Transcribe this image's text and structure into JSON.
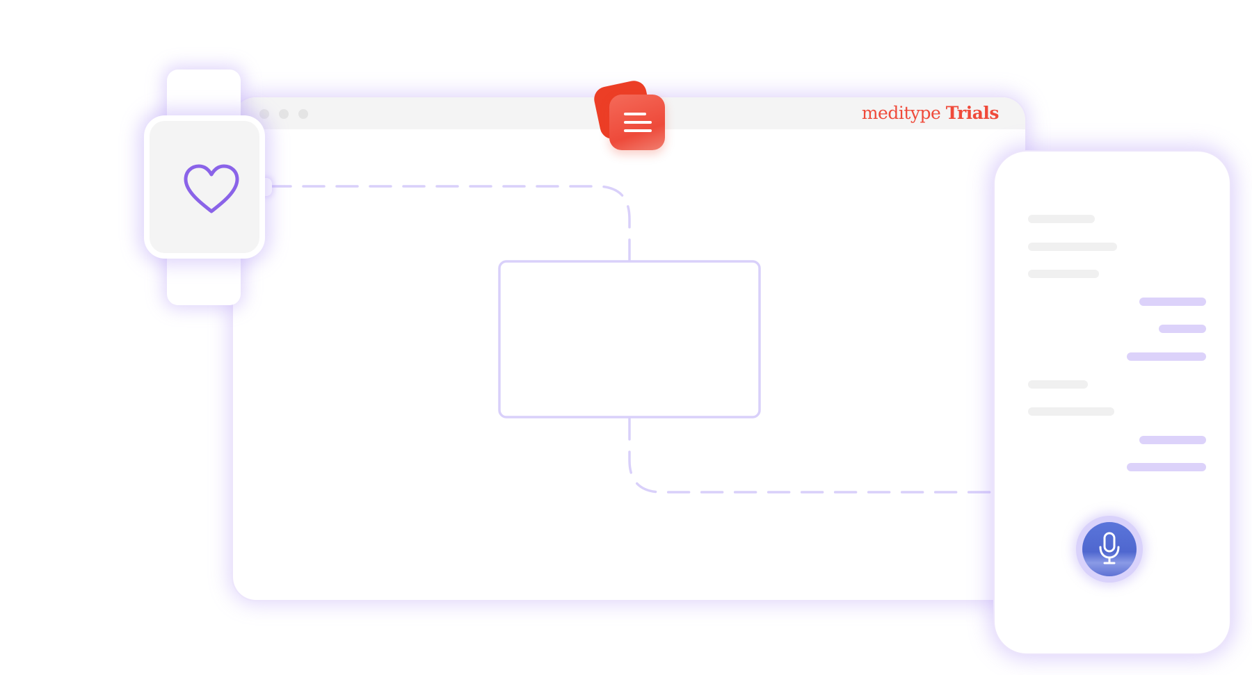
{
  "browser": {
    "brand": {
      "name": "meditype",
      "product": "Trials",
      "color": "#ef4a3a"
    },
    "window_controls": [
      "dot",
      "dot",
      "dot"
    ]
  },
  "watch": {
    "screen_icon": "heart-icon"
  },
  "app_badge": {
    "icon": "menu-icon",
    "color": "#ec3e26"
  },
  "phone": {
    "messages": [
      {
        "side": "incoming"
      },
      {
        "side": "incoming"
      },
      {
        "side": "incoming"
      },
      {
        "side": "outgoing"
      },
      {
        "side": "outgoing"
      },
      {
        "side": "outgoing"
      },
      {
        "side": "incoming"
      },
      {
        "side": "incoming"
      },
      {
        "side": "outgoing"
      },
      {
        "side": "outgoing"
      }
    ],
    "action_button_icon": "microphone-icon"
  },
  "colors": {
    "accent_purple": "#8a63e8",
    "outline_lavender": "#d9d0fa",
    "brand_red": "#ef4a3a",
    "mic_blue": "#5570d6"
  }
}
